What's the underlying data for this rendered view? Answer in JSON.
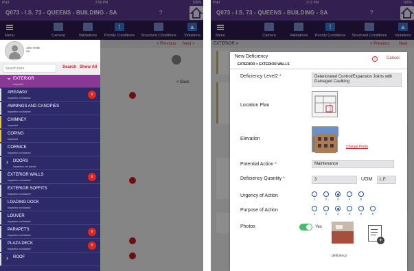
{
  "left": {
    "status": {
      "carrier": "iPad",
      "time": "3:06 PM",
      "battery": "100%"
    },
    "title": "Q073 - I.S. 73 - QUEENS - BUILDING - SA",
    "help": "?",
    "toolbar": [
      "Menu",
      "Camera",
      "Validations",
      "Priority Conditions",
      "Structural Conditions",
      "Violations"
    ],
    "nav": {
      "previous": "< Previous",
      "next": "Next >"
    },
    "back": "< Back",
    "profile": {
      "name": "John Smith",
      "org": "SA"
    },
    "search": {
      "placeholder": "Search here",
      "search_label": "Search",
      "show_all_label": "Show All"
    },
    "items": [
      {
        "name": "EXTERIOR",
        "status": "Inspected",
        "active": true,
        "expand": "down"
      },
      {
        "name": "AREAWAY",
        "status": "Inspection not started",
        "badge": "0"
      },
      {
        "name": "AWNINGS AND CANOPIES",
        "status": "Inspection not started"
      },
      {
        "name": "CHIMNEY",
        "status": "Inspected"
      },
      {
        "name": "COPING",
        "status": "Inspected"
      },
      {
        "name": "CORNICE",
        "status": "Inspection not started"
      },
      {
        "name": "DOORS",
        "status": "Inspection not started",
        "expand": "right"
      },
      {
        "name": "EXTERIOR WALLS",
        "status": "Inspection not started",
        "badge": "0"
      },
      {
        "name": "EXTERIOR SOFFITS",
        "status": "Inspection not started"
      },
      {
        "name": "LOADING DOCK",
        "status": "Inspection not started"
      },
      {
        "name": "LOUVER",
        "status": "Inspection not started"
      },
      {
        "name": "PARAPETS",
        "status": "Inspection not started",
        "badge": "0"
      },
      {
        "name": "PLAZA DECK",
        "status": "Inspection not started",
        "badge": "0"
      },
      {
        "name": "ROOF",
        "status": "",
        "expand": "right"
      }
    ],
    "colors": {
      "purple": "#5d3a93",
      "drawer": "#2d2a6a",
      "active": "#8a3896",
      "badge": "#e0261e"
    }
  },
  "right": {
    "status": {
      "carrier": "iPad",
      "time": "3:11 PM",
      "battery": "100%"
    },
    "title": "Q073 - I.S. 73 - QUEENS - BUILDING - SA",
    "help": "?",
    "breadcrumb": "EXTERIOR >",
    "nav": {
      "previous": "< Previous",
      "next": "Next"
    },
    "modal": {
      "title": "New Deficiency",
      "subtitle": "EXTERIOR > EXTERIOR WALLS",
      "info": "i",
      "cancel": "Cancel",
      "level2_label": "Deficiency Level2",
      "level2_value": "Deteriorated Control/Expansion Joints with Damaged Caulking",
      "location_label": "Location Plan",
      "elevation_label": "Elevation",
      "change_photo": "Change Photo",
      "potential_label": "Potential Action",
      "potential_value": "Maintenance",
      "quantity_label": "Deficiency Quantity",
      "quantity_value": "3",
      "uom_label": "UOM",
      "uom_value": "L.F.",
      "urgency_label": "Urgency of Action",
      "urgency_options": [
        "1",
        "2",
        "3",
        "4",
        "5"
      ],
      "urgency_selected": 3,
      "purpose_label": "Purpose of Action",
      "purpose_options": [
        "1",
        "2",
        "3",
        "4",
        "5",
        "6"
      ],
      "purpose_selected": 3,
      "photos_label": "Photos",
      "photos_toggle": "Yes",
      "photo_caption": "deficiency"
    }
  }
}
